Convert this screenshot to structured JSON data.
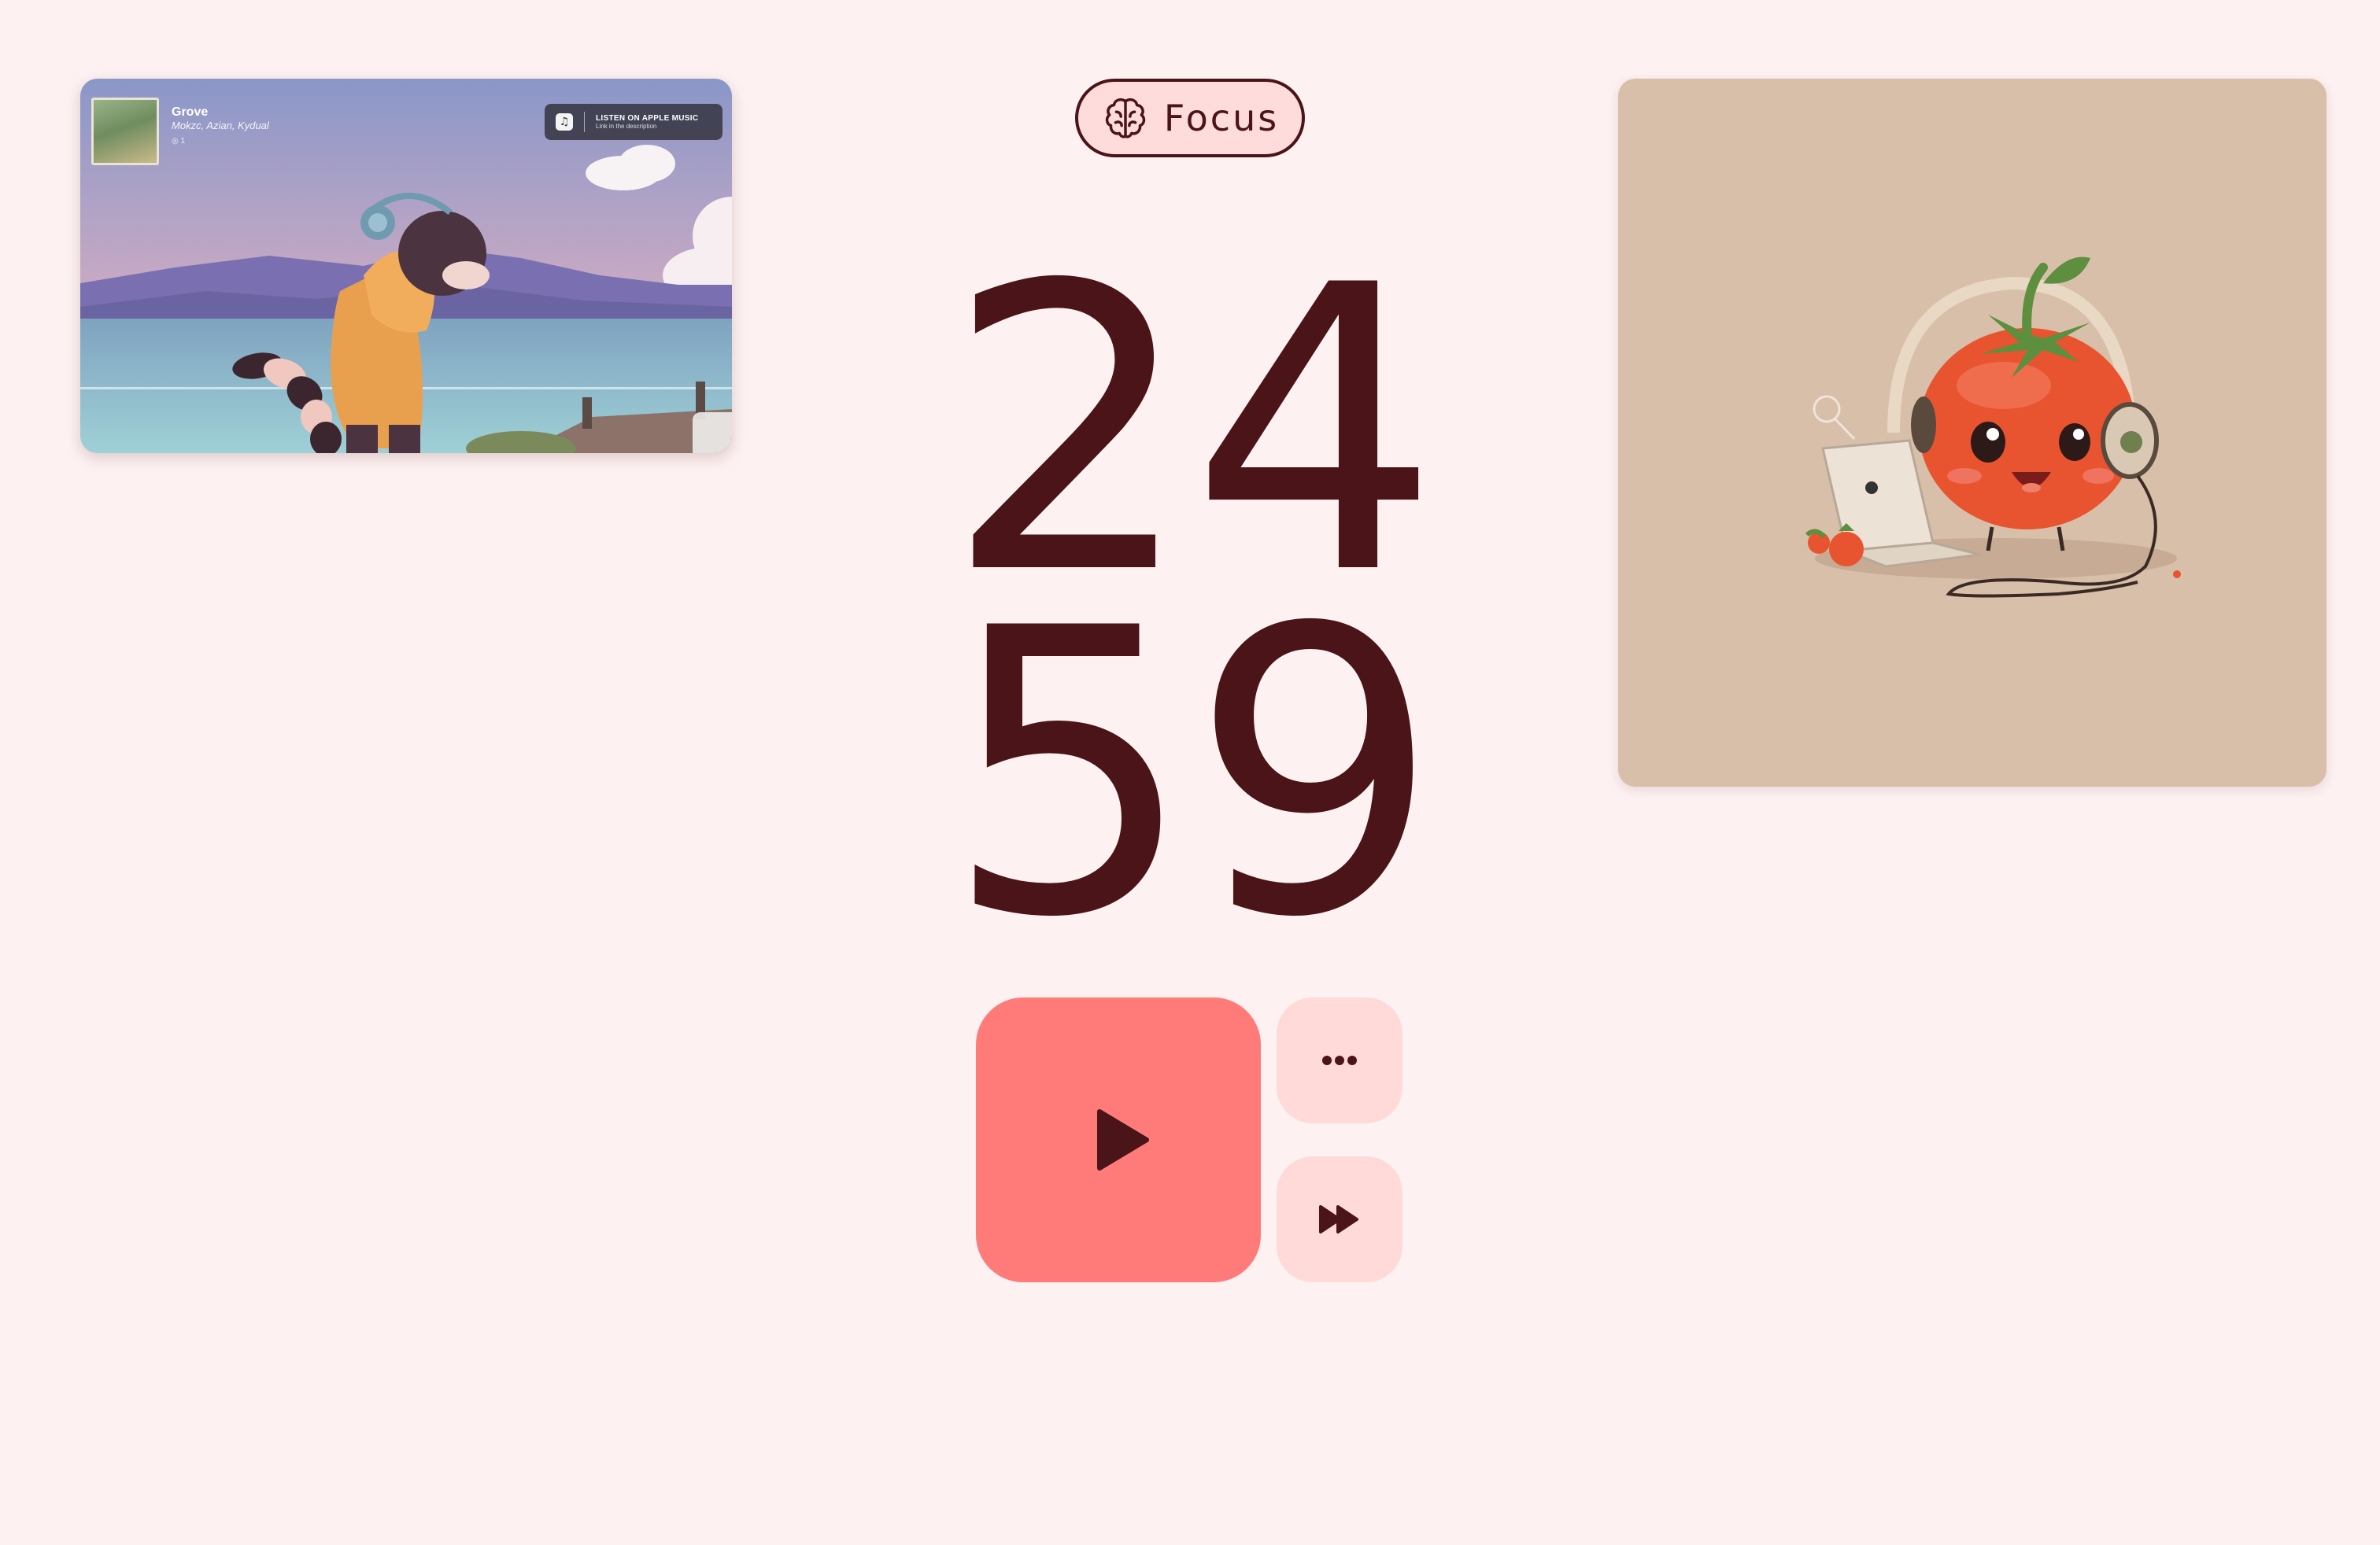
{
  "video": {
    "track_title": "Grove",
    "track_artists": "Mokzc, Azian, Kydual",
    "track_extra": "◎ 1",
    "apple_music_label": "LISTEN ON APPLE MUSIC",
    "apple_music_sub": "Link in the description"
  },
  "mode": {
    "label": "Focus",
    "icon": "brain-icon"
  },
  "timer": {
    "minutes": "24",
    "seconds": "59"
  },
  "controls": {
    "play_icon": "play-icon",
    "more_icon": "more-horizontal-icon",
    "skip_icon": "fast-forward-icon"
  },
  "colors": {
    "background": "#fdf1f1",
    "text_primary": "#4a1418",
    "play_button": "#ff7b7a",
    "secondary_button": "#ffdad9",
    "art_card": "#d8bfa9"
  }
}
